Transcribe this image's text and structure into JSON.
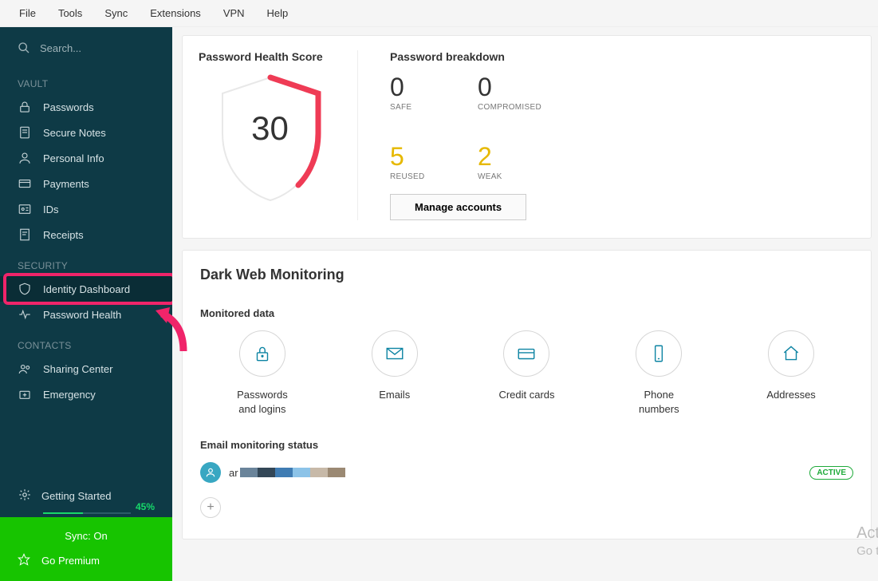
{
  "menubar": [
    "File",
    "Tools",
    "Sync",
    "Extensions",
    "VPN",
    "Help"
  ],
  "search": {
    "placeholder": "Search..."
  },
  "sidebar": {
    "vault_label": "VAULT",
    "vault_items": [
      {
        "name": "passwords",
        "label": "Passwords"
      },
      {
        "name": "secure-notes",
        "label": "Secure Notes"
      },
      {
        "name": "personal-info",
        "label": "Personal Info"
      },
      {
        "name": "payments",
        "label": "Payments"
      },
      {
        "name": "ids",
        "label": "IDs"
      },
      {
        "name": "receipts",
        "label": "Receipts"
      }
    ],
    "security_label": "SECURITY",
    "security_items": [
      {
        "name": "identity-dashboard",
        "label": "Identity Dashboard",
        "active": true
      },
      {
        "name": "password-health",
        "label": "Password Health"
      }
    ],
    "contacts_label": "CONTACTS",
    "contacts_items": [
      {
        "name": "sharing-center",
        "label": "Sharing Center"
      },
      {
        "name": "emergency",
        "label": "Emergency"
      }
    ],
    "getting_started": {
      "label": "Getting Started",
      "percent_text": "45%",
      "percent_num": 45
    },
    "sync_label": "Sync: On",
    "premium_label": "Go Premium"
  },
  "health": {
    "title": "Password Health Score",
    "score": "30",
    "breakdown_title": "Password breakdown",
    "items": [
      {
        "num": "0",
        "label": "SAFE",
        "cls": "num-black"
      },
      {
        "num": "0",
        "label": "COMPROMISED",
        "cls": "num-black"
      },
      {
        "num": "5",
        "label": "REUSED",
        "cls": "num-amber"
      },
      {
        "num": "2",
        "label": "WEAK",
        "cls": "num-amber"
      }
    ],
    "manage_label": "Manage accounts"
  },
  "dwm": {
    "title": "Dark Web Monitoring",
    "monitored_label": "Monitored data",
    "items": [
      {
        "name": "passwords-logins",
        "label": "Passwords\nand logins"
      },
      {
        "name": "emails",
        "label": "Emails"
      },
      {
        "name": "credit-cards",
        "label": "Credit cards"
      },
      {
        "name": "phone-numbers",
        "label": "Phone\nnumbers"
      },
      {
        "name": "addresses",
        "label": "Addresses"
      }
    ],
    "email_status_label": "Email monitoring status",
    "email_prefix": "ar",
    "mask_colors": [
      "#6a849a",
      "#334757",
      "#3f7cb3",
      "#8cc3e8",
      "#c7b9a8",
      "#9b8973"
    ],
    "active_label": "ACTIVE",
    "add_label": "+"
  },
  "watermark": {
    "l1": "Act",
    "l2": "Go t"
  },
  "colors": {
    "accent": "#0d84a3",
    "highlight": "#f0246a",
    "green": "#17c400"
  }
}
